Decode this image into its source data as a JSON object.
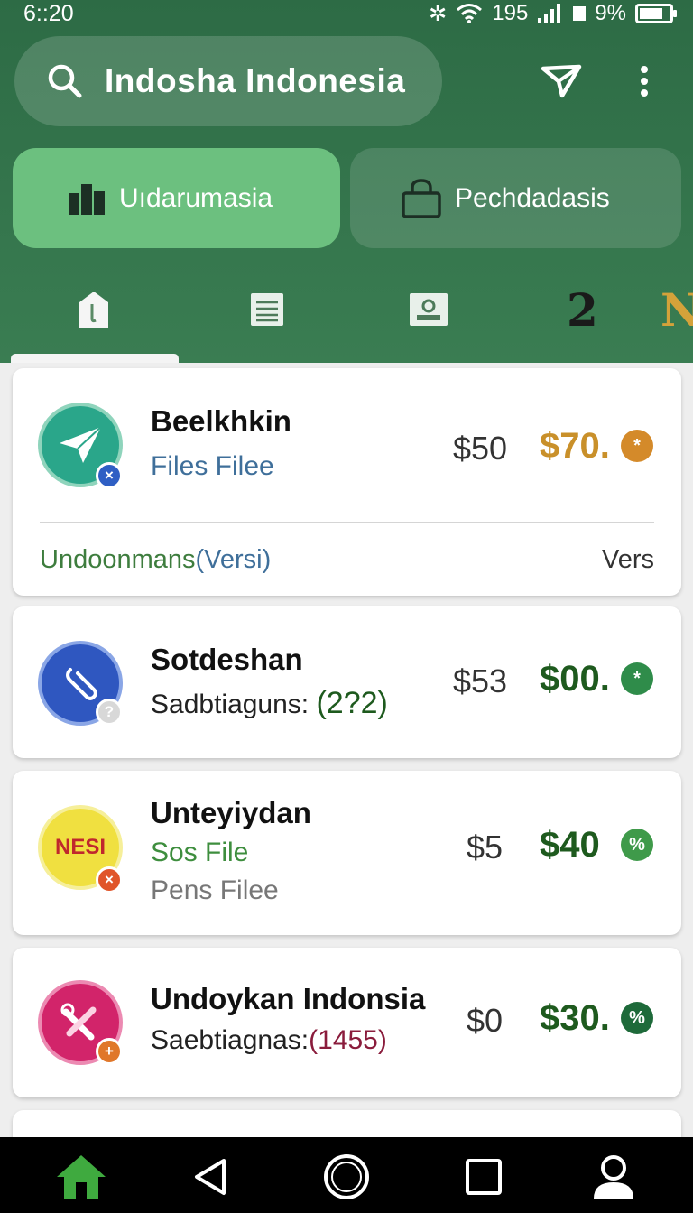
{
  "status_bar": {
    "time": "6::20",
    "signal_text": "195",
    "battery": "9%"
  },
  "search": {
    "value": "Indosha  Indonesia"
  },
  "categories": [
    {
      "label": "Uıdarumasia",
      "active": true
    },
    {
      "label": "Pechdadasis",
      "active": false
    }
  ],
  "tabs": {
    "number_tab": "2",
    "letter_tab": "N"
  },
  "cards": [
    {
      "title": "Beelkhkin",
      "subtitle": "Files Filee",
      "price_old": "$50",
      "price_new": "$70.",
      "price_icon": "*",
      "badge": "×",
      "footer_left": "Undoonmans",
      "footer_left_paren": "(Versi)",
      "footer_right": "Vers"
    },
    {
      "title": "Sotdeshan",
      "subtitle_prefix": "Sadbtiaguns:",
      "subtitle_count": "(2?2)",
      "price_old": "$53",
      "price_new": "$00.",
      "price_icon": "*",
      "badge": "?"
    },
    {
      "title": "Unteyiydan",
      "subtitle": "Sos File",
      "subtitle2": "Pens Filee",
      "logo_text": "NESI",
      "price_old": "$5",
      "price_new": "$40",
      "price_icon": "%",
      "badge": "×"
    },
    {
      "title": "Undoykan Indonsia",
      "subtitle_prefix": "Saebtiagnas:",
      "subtitle_count": "(1455)",
      "price_old": "$0",
      "price_new": "$30.",
      "price_icon": "%",
      "badge": "+"
    }
  ],
  "colors": {
    "header": "#2d6b45",
    "active_tab": "#6cc07f",
    "gold": "#c9902a",
    "dark_green": "#1e5a1e",
    "maroon": "#8a1c3c"
  },
  "icons": {
    "search": "search-icon",
    "send": "send-icon",
    "menu": "more-vert-icon",
    "home": "home-icon",
    "back": "back-icon",
    "circle": "home-circle-icon",
    "recents": "recents-icon",
    "profile": "profile-icon"
  }
}
